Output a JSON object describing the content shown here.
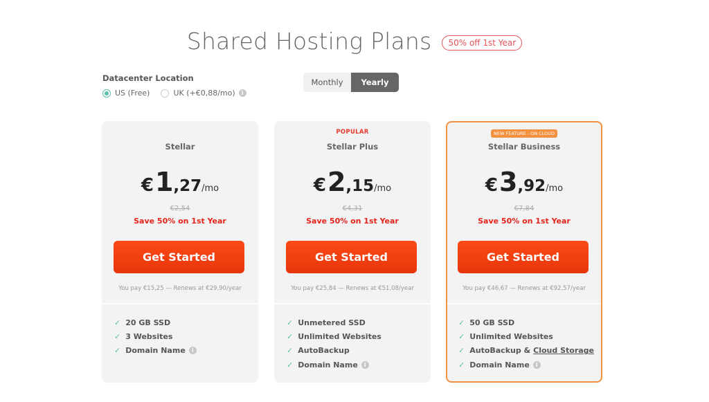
{
  "header": {
    "title": "Shared Hosting Plans",
    "badge": "50% off 1st Year"
  },
  "datacenter": {
    "label": "Datacenter Location",
    "options": [
      {
        "label": "US (Free)",
        "selected": true
      },
      {
        "label": "UK (+€0,88/mo)",
        "selected": false,
        "info_icon": "info-icon"
      }
    ]
  },
  "billing_toggle": {
    "options": [
      "Monthly",
      "Yearly"
    ],
    "selected": "Yearly"
  },
  "colors": {
    "accent_red": "#e5231b",
    "button_orange": "#f5420f",
    "featured_border": "#f3913f",
    "check_teal": "#5bbfab"
  },
  "plans": [
    {
      "tag": "",
      "name": "Stellar",
      "currency": "€",
      "price_int": "1",
      "price_dec": ",27",
      "per": "/mo",
      "old_price": "€2,54",
      "save": "Save 50% on 1st Year",
      "cta": "Get Started",
      "renew": "You pay €15,25 — Renews at €29,90/year",
      "features": [
        "20 GB SSD",
        "3 Websites",
        "Domain Name"
      ]
    },
    {
      "tag": "POPULAR",
      "name": "Stellar Plus",
      "currency": "€",
      "price_int": "2",
      "price_dec": ",15",
      "per": "/mo",
      "old_price": "€4,31",
      "save": "Save 50% on 1st Year",
      "cta": "Get Started",
      "renew": "You pay €25,84 — Renews at €51,08/year",
      "features": [
        "Unmetered SSD",
        "Unlimited Websites",
        "AutoBackup",
        "Domain Name"
      ]
    },
    {
      "tag": "NEW FEATURE - ON CLOUD",
      "name": "Stellar Business",
      "currency": "€",
      "price_int": "3",
      "price_dec": ",92",
      "per": "/mo",
      "old_price": "€7,84",
      "save": "Save 50% on 1st Year",
      "cta": "Get Started",
      "renew": "You pay €46,67 — Renews at €92,57/year",
      "features": [
        "50 GB SSD",
        "Unlimited Websites",
        "AutoBackup &",
        "Domain Name"
      ],
      "feature_link": "Cloud Storage"
    }
  ],
  "icons": {
    "check": "✓",
    "info": "i"
  }
}
